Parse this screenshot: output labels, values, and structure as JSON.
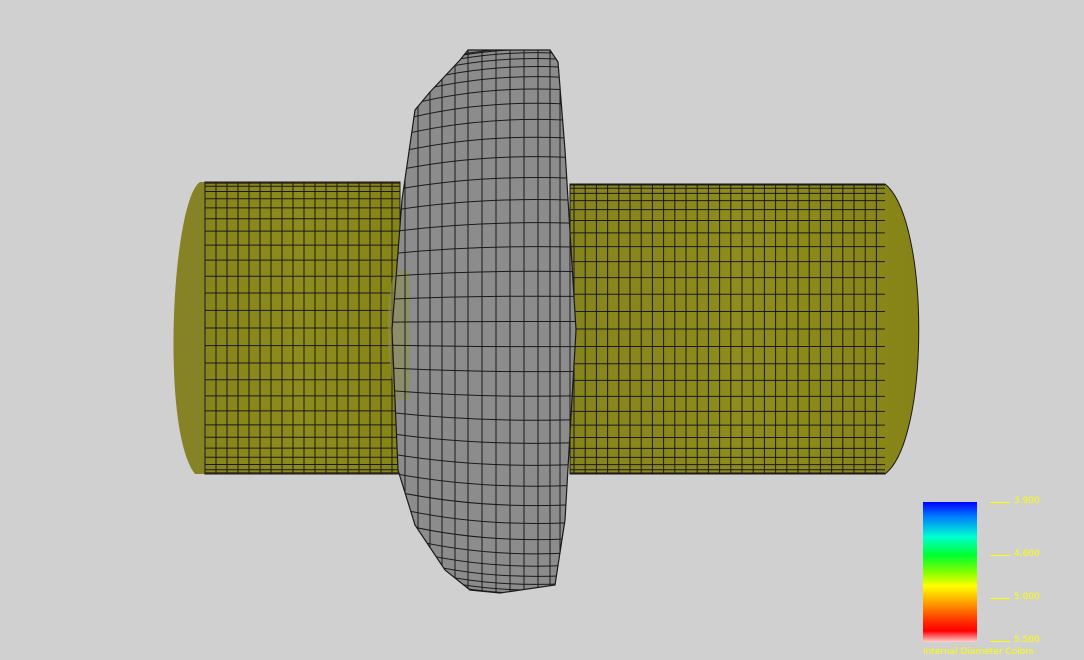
{
  "legend": {
    "title": "Internal Diameter Colors",
    "ticks": [
      "3.900",
      "4.600",
      "5.000",
      "5.500"
    ]
  },
  "colors": {
    "background": "#d0d0d0",
    "pipe": "#8c8a1a",
    "pipe_end": "#858224",
    "bulge": "#8c8c8c",
    "grid": "#1a1a1a",
    "legend_text": "#ffff00"
  }
}
